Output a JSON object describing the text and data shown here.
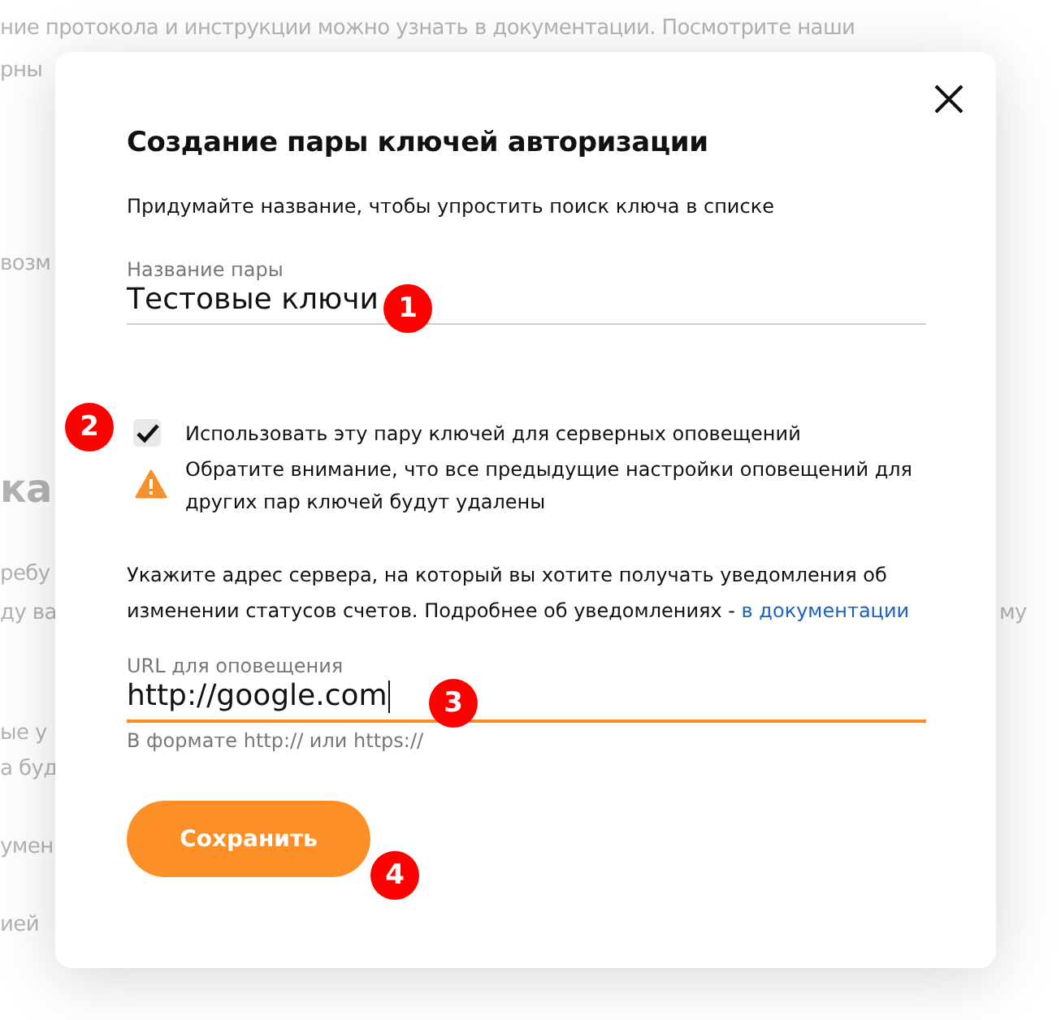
{
  "background": {
    "lines": [
      {
        "text": "ние протокола и инструкции можно узнать в документации. Посмотрите наши",
        "kind": "text"
      },
      {
        "text": "рны",
        "kind": "text"
      },
      {
        "text": "возм",
        "kind": "text"
      },
      {
        "text": "ка",
        "kind": "heading"
      },
      {
        "text": "ребу",
        "kind": "text"
      },
      {
        "text": "ду ва",
        "kind": "text"
      },
      {
        "text": "му",
        "kind": "text"
      },
      {
        "text": "ые у",
        "kind": "text"
      },
      {
        "text": "а буд",
        "kind": "text"
      },
      {
        "text": "умен",
        "kind": "text"
      },
      {
        "text": "ией",
        "kind": "text"
      }
    ]
  },
  "dialog": {
    "title": "Создание пары ключей авторизации",
    "subtitle": "Придумайте название, чтобы упростить поиск ключа в списке",
    "name_field": {
      "label": "Название пары",
      "value": "Тестовые ключи",
      "focused": false
    },
    "notify_checkbox": {
      "label": "Использовать эту пару ключей для серверных оповещений",
      "checked": true
    },
    "warning": "Обратите внимание, что все предыдущие настройки оповещений для других пар ключей будут удалены",
    "info": {
      "text": "Укажите адрес сервера, на который вы хотите получать уведомления об изменении статусов счетов. Подробнее об уведомлениях -",
      "link": "в документации"
    },
    "url_field": {
      "label": "URL для оповещения",
      "value": "http://google.com",
      "focused": true,
      "hint": "В формате http:// или https://"
    },
    "save_button": "Сохранить"
  },
  "annotations": [
    "1",
    "2",
    "3",
    "4"
  ]
}
